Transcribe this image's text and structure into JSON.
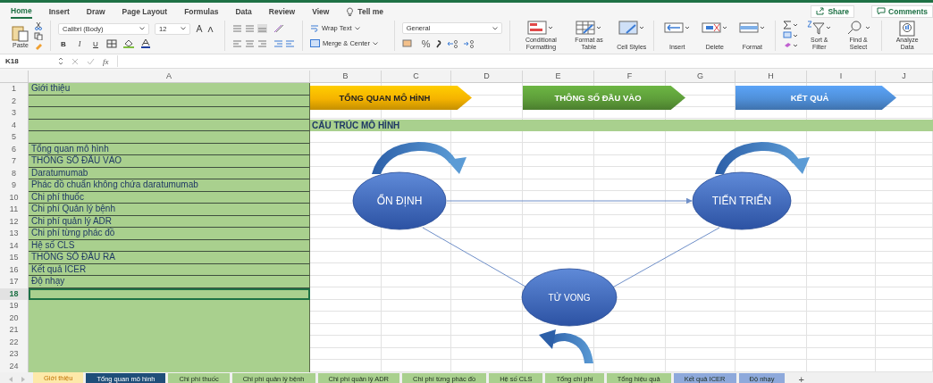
{
  "menu_tabs": [
    {
      "label": "Home",
      "selected": true
    },
    {
      "label": "Insert",
      "selected": false
    },
    {
      "label": "Draw",
      "selected": false
    },
    {
      "label": "Page Layout",
      "selected": false
    },
    {
      "label": "Formulas",
      "selected": false
    },
    {
      "label": "Data",
      "selected": false
    },
    {
      "label": "Review",
      "selected": false
    },
    {
      "label": "View",
      "selected": false
    }
  ],
  "tell_me": "Tell me",
  "share": "Share",
  "comments": "Comments",
  "ribbon": {
    "paste": "Paste",
    "font": "Calibri (Body)",
    "font_size": "12",
    "bold": "B",
    "italic": "I",
    "underline": "U",
    "wrap_text": "Wrap Text",
    "merge": "Merge & Center",
    "number_format": "General",
    "percent": "%",
    "large_buttons": [
      {
        "label": "Conditional Formatting",
        "kind": "conditional"
      },
      {
        "label": "Format as Table",
        "kind": "table"
      },
      {
        "label": "Cell Styles",
        "kind": "styles"
      },
      {
        "label": "Insert",
        "kind": "insert"
      },
      {
        "label": "Delete",
        "kind": "delete"
      },
      {
        "label": "Format",
        "kind": "format"
      }
    ],
    "editing": [
      {
        "label": "Sort & Filter",
        "kind": "sort"
      },
      {
        "label": "Find & Select",
        "kind": "find"
      },
      {
        "label": "Analyze Data",
        "kind": "analyze"
      }
    ]
  },
  "formula_bar": {
    "name_box": "K18",
    "fx": "fx"
  },
  "columns": [
    "A",
    "B",
    "C",
    "D",
    "E",
    "F",
    "G",
    "H",
    "I",
    "J"
  ],
  "rows": [
    {
      "number": "1",
      "text": "Giới thiệu",
      "selected": false
    },
    {
      "number": "2",
      "selected": false
    },
    {
      "number": "3",
      "selected": false
    },
    {
      "number": "4",
      "selected": false
    },
    {
      "number": "5",
      "selected": false
    },
    {
      "number": "6",
      "text": "Tổng quan mô hình",
      "selected": false
    },
    {
      "number": "7",
      "text": "THÔNG SỐ ĐẦU VÀO",
      "selected": false
    },
    {
      "number": "8",
      "text": "Daratumumab",
      "selected": false
    },
    {
      "number": "9",
      "text": "Phác đồ chuẩn không chứa daratumumab",
      "selected": false
    },
    {
      "number": "10",
      "text": "Chi phí thuốc",
      "selected": false
    },
    {
      "number": "11",
      "text": "Chi phí Quản lý bệnh",
      "selected": false
    },
    {
      "number": "12",
      "text": "Chi phí quản lý ADR",
      "selected": false
    },
    {
      "number": "13",
      "text": "Chi phí từng phác đồ",
      "selected": false
    },
    {
      "number": "14",
      "text": "Hệ số CLS",
      "selected": false
    },
    {
      "number": "15",
      "text": "THÔNG SỐ ĐẦU RA",
      "selected": false
    },
    {
      "number": "16",
      "text": "Kết quả ICER",
      "selected": false
    },
    {
      "number": "17",
      "text": "Độ nhạy",
      "selected": false
    },
    {
      "number": "18",
      "selected": true
    },
    {
      "number": "19",
      "selected": false
    },
    {
      "number": "20",
      "selected": false
    },
    {
      "number": "21",
      "selected": false
    },
    {
      "number": "22",
      "selected": false
    },
    {
      "number": "23",
      "selected": false
    },
    {
      "number": "24",
      "selected": false
    }
  ],
  "banners": [
    {
      "label": "TỔNG QUAN MÔ HÌNH",
      "color": "#f5b300"
    },
    {
      "label": "THÔNG SỐ ĐẦU VÀO",
      "color": "#5e9e3a"
    },
    {
      "label": "KẾT QUẢ",
      "color": "#4f8fd8"
    }
  ],
  "section_title": "CẤU TRÚC MÔ HÌNH",
  "diagram": {
    "nodes": [
      {
        "label": "ỔN ĐỊNH"
      },
      {
        "label": "TIẾN TRIỂN"
      },
      {
        "label": "TỬ VONG"
      }
    ]
  },
  "sheet_tabs": [
    {
      "label": "Giới thiệu",
      "color": "#fde9a9",
      "selected": true
    },
    {
      "label": "Tổng quan mô hình",
      "color": "#1f4e79",
      "selected": false
    },
    {
      "label": "Chi phí thuốc",
      "color": "#a9d08e",
      "selected": false
    },
    {
      "label": "Chi phí quản lý bệnh",
      "color": "#a9d08e",
      "selected": false
    },
    {
      "label": "Chi phí quản lý ADR",
      "color": "#a9d08e",
      "selected": false
    },
    {
      "label": "Chi phí từng phác đồ",
      "color": "#a9d08e",
      "selected": false
    },
    {
      "label": "Hệ số CLS",
      "color": "#a9d08e",
      "selected": false
    },
    {
      "label": "Tổng chi phí",
      "color": "#a9d08e",
      "selected": false
    },
    {
      "label": "Tổng hiệu quả",
      "color": "#a9d08e",
      "selected": false
    },
    {
      "label": "Kết quả ICER",
      "color": "#8ea9db",
      "selected": false
    },
    {
      "label": "Độ nhạy",
      "color": "#8ea9db",
      "selected": false
    }
  ],
  "add_sheet": "+"
}
